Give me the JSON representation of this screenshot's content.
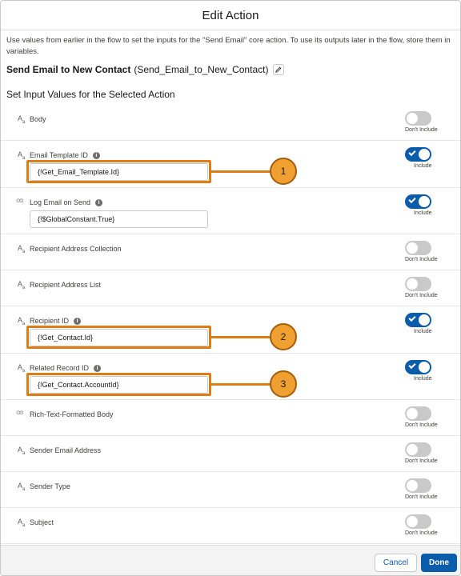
{
  "header": {
    "title": "Edit Action"
  },
  "description": "Use values from earlier in the flow to set the inputs for the \"Send Email\" core action. To use its outputs later in the flow, store them in variables.",
  "action": {
    "label": "Send Email to New Contact",
    "api_name": "(Send_Email_to_New_Contact)"
  },
  "section_title": "Set Input Values for the Selected Action",
  "type_icons": {
    "text": "A",
    "text_sub": "a",
    "boolean": "⊙⊙"
  },
  "rows": [
    {
      "label": "Body",
      "type": "text",
      "toggle": "off",
      "toggle_label": "Don't Include"
    },
    {
      "label": "Email Template ID",
      "type": "text",
      "info": true,
      "value": "{!Get_Email_Template.Id}",
      "toggle": "on",
      "toggle_label": "Include",
      "callout": "1"
    },
    {
      "label": "Log Email on Send",
      "type": "boolean",
      "info": true,
      "value": "{!$GlobalConstant.True}",
      "toggle": "on",
      "toggle_label": "Include"
    },
    {
      "label": "Recipient Address Collection",
      "type": "text",
      "toggle": "off",
      "toggle_label": "Don't Include"
    },
    {
      "label": "Recipient Address List",
      "type": "text",
      "toggle": "off",
      "toggle_label": "Don't Include"
    },
    {
      "label": "Recipient ID",
      "type": "text",
      "info": true,
      "value": "{!Get_Contact.Id}",
      "toggle": "on",
      "toggle_label": "Include",
      "callout": "2"
    },
    {
      "label": "Related Record ID",
      "type": "text",
      "info": true,
      "value": "{!Get_Contact.AccountId}",
      "toggle": "on",
      "toggle_label": "Include",
      "callout": "3"
    },
    {
      "label": "Rich-Text-Formatted Body",
      "type": "boolean",
      "toggle": "off",
      "toggle_label": "Don't Include"
    },
    {
      "label": "Sender Email Address",
      "type": "text",
      "toggle": "off",
      "toggle_label": "Don't Include"
    },
    {
      "label": "Sender Type",
      "type": "text",
      "toggle": "off",
      "toggle_label": "Don't Include"
    },
    {
      "label": "Subject",
      "type": "text",
      "toggle": "off",
      "toggle_label": "Don't Include"
    }
  ],
  "info_glyph": "i",
  "footer": {
    "cancel_label": "Cancel",
    "done_label": "Done"
  },
  "colors": {
    "brand": "#0b5cab",
    "callout": "#f0a030",
    "highlight": "#e07c16"
  }
}
